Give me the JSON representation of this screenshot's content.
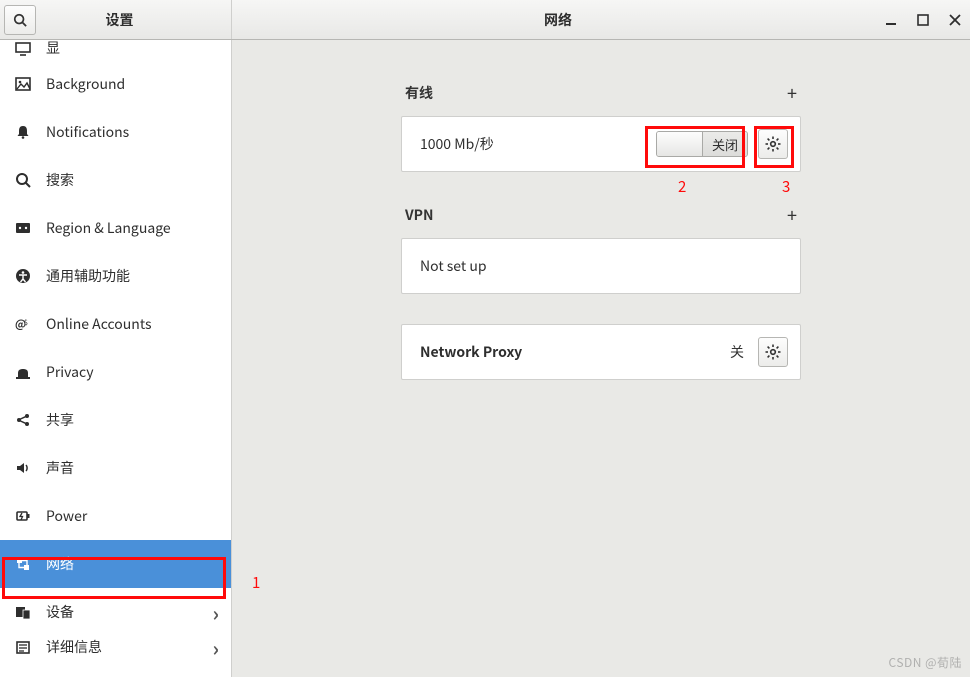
{
  "header": {
    "sidebar_title": "设置",
    "main_title": "网络"
  },
  "sidebar": {
    "items": [
      {
        "label": "显",
        "icon": "monitor-icon",
        "nav": false,
        "partial": true
      },
      {
        "label": "Background",
        "icon": "background-icon",
        "nav": false
      },
      {
        "label": "Notifications",
        "icon": "bell-icon",
        "nav": false
      },
      {
        "label": "搜索",
        "icon": "search-icon",
        "nav": false
      },
      {
        "label": "Region & Language",
        "icon": "region-icon",
        "nav": false
      },
      {
        "label": "通用辅助功能",
        "icon": "accessibility-icon",
        "nav": false
      },
      {
        "label": "Online Accounts",
        "icon": "online-accounts-icon",
        "nav": false
      },
      {
        "label": "Privacy",
        "icon": "privacy-icon",
        "nav": false
      },
      {
        "label": "共享",
        "icon": "share-icon",
        "nav": false
      },
      {
        "label": "声音",
        "icon": "sound-icon",
        "nav": false
      },
      {
        "label": "Power",
        "icon": "power-icon",
        "nav": false
      },
      {
        "label": "网络",
        "icon": "network-icon",
        "nav": false,
        "selected": true
      },
      {
        "label": "设备",
        "icon": "devices-icon",
        "nav": true
      },
      {
        "label": "详细信息",
        "icon": "details-icon",
        "nav": true,
        "partialBottom": true
      }
    ]
  },
  "wired": {
    "title": "有线",
    "speed": "1000 Mb/秒",
    "toggle_label": "关闭"
  },
  "vpn": {
    "title": "VPN",
    "status": "Not set up"
  },
  "proxy": {
    "title": "Network Proxy",
    "status": "关"
  },
  "annotations": {
    "n1": "1",
    "n2": "2",
    "n3": "3"
  },
  "watermark": "CSDN @荀陆"
}
